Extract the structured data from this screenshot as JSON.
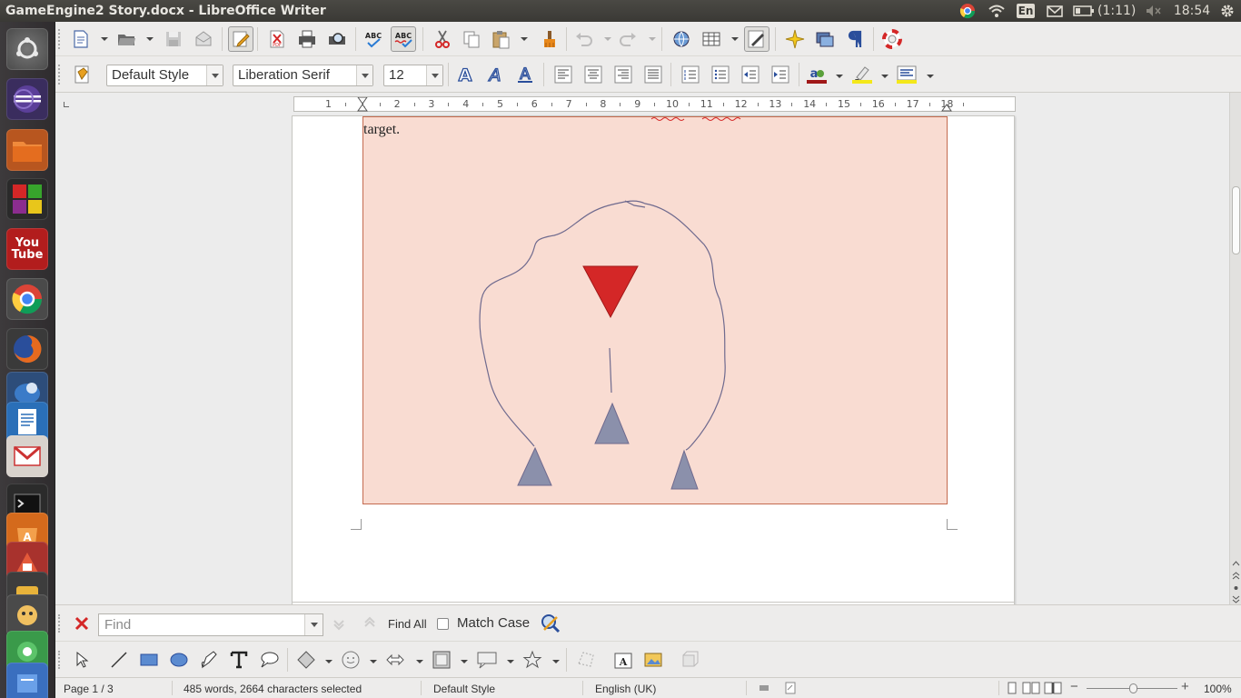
{
  "window": {
    "title": "GameEngine2 Story.docx - LibreOffice Writer"
  },
  "top_panel": {
    "keyboard_layout": "En",
    "battery": "(1:11)",
    "clock": "18:54",
    "icons": [
      "chrome-icon",
      "wifi-icon",
      "keyboard-icon",
      "mail-icon",
      "battery-icon",
      "volume-muted-icon",
      "settings-gear-icon"
    ]
  },
  "launcher": {
    "items": [
      "ubuntu-dash",
      "eclipse",
      "files",
      "libreoffice-impress",
      "youtube",
      "google-chrome",
      "firefox",
      "thunderbird",
      "libreoffice-writer",
      "gmail",
      "terminal",
      "software-center",
      "app",
      "app",
      "app",
      "app",
      "app"
    ],
    "youtube_label_1": "You",
    "youtube_label_2": "Tube"
  },
  "formatting": {
    "paragraph_style": "Default Style",
    "font_name": "Liberation Serif",
    "font_size": "12"
  },
  "ruler": {
    "labels": [
      "1",
      "1",
      "2",
      "3",
      "4",
      "5",
      "6",
      "7",
      "8",
      "9",
      "10",
      "11",
      "12",
      "13",
      "14",
      "15",
      "16",
      "17",
      "18"
    ]
  },
  "document": {
    "visible_text": "target."
  },
  "colors": {
    "frame_fill": "#f9dcd2",
    "frame_border": "#c46a4f",
    "enemy_triangle": "#d42727",
    "player_triangles": "#8b90ab",
    "outline": "#6f6a8e"
  },
  "find": {
    "placeholder": "Find",
    "find_all_label": "Find All",
    "match_case_label": "Match Case",
    "match_case_checked": false
  },
  "status": {
    "page": "Page 1 / 3",
    "words": "485 words, 2664 characters selected",
    "style": "Default Style",
    "language": "English (UK)",
    "zoom": "100%"
  }
}
